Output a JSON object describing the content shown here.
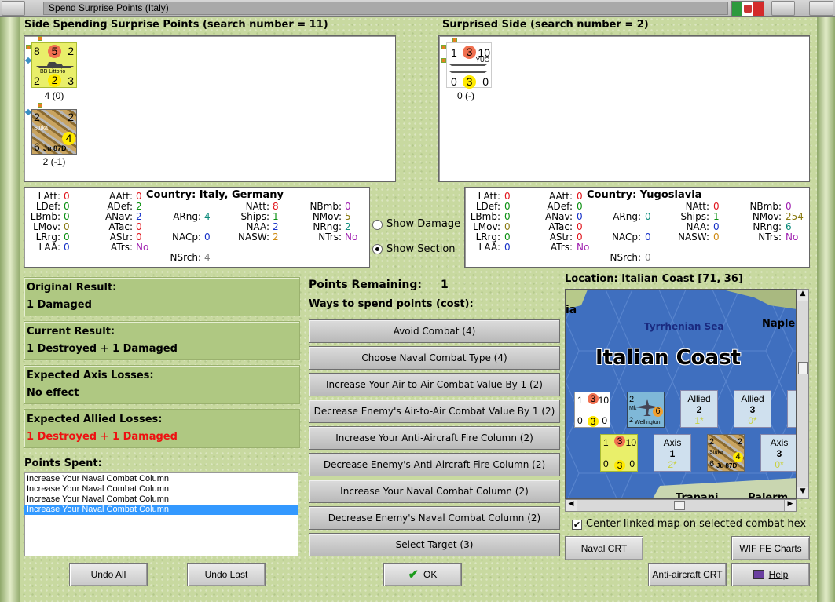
{
  "window": {
    "title": "Spend Surprise Points (Italy)",
    "flag": {
      "colors": [
        "#2e9a3e",
        "#ffffff",
        "#d42a2a"
      ]
    }
  },
  "spending": {
    "header": "Side Spending Surprise Points (search number = 11)",
    "units": [
      {
        "name": "BB Littorio",
        "tl": "8",
        "tc": "5",
        "tr": "2",
        "bl": "2",
        "bc": "2",
        "br": "3",
        "stat": "4 (0)"
      },
      {
        "name": "Ju 87D",
        "tl": "2",
        "tr": "2",
        "bl": "6",
        "br": "4",
        "side": "Stuka",
        "stat": "2 (-1)"
      }
    ]
  },
  "surprised": {
    "header": "Surprised Side (search number = 2)",
    "units": [
      {
        "name": "YUG",
        "tl": "1",
        "tc": "3",
        "tr": "10",
        "bl": "0",
        "bc": "3",
        "br": "0",
        "stat": "0 (-)"
      }
    ]
  },
  "left_stats": {
    "country_label": "Country:",
    "country": "Italy, Germany",
    "col1": [
      [
        "LAtt:",
        "0"
      ],
      [
        "LDef:",
        "0"
      ],
      [
        "LBmb:",
        "0"
      ],
      [
        "LMov:",
        "0"
      ],
      [
        "LRrg:",
        "0"
      ],
      [
        "LAA:",
        "0"
      ]
    ],
    "col2": [
      [
        "AAtt:",
        "0"
      ],
      [
        "ADef:",
        "2"
      ],
      [
        "ANav:",
        "2"
      ],
      [
        "ATac:",
        "0"
      ],
      [
        "AStr:",
        "0"
      ],
      [
        "ATrs:",
        "No"
      ]
    ],
    "col3": [
      [
        "ARng:",
        "4"
      ],
      [
        "NACp:",
        "0"
      ],
      [
        "NSrch:",
        "4"
      ]
    ],
    "col4": [
      [
        "NAtt:",
        "8"
      ],
      [
        "Ships:",
        "1"
      ],
      [
        "NAA:",
        "2"
      ],
      [
        "NASW:",
        "2"
      ]
    ],
    "col5": [
      [
        "NBmb:",
        "0"
      ],
      [
        "NMov:",
        "5"
      ],
      [
        "NRng:",
        "2"
      ],
      [
        "NTrs:",
        "No"
      ]
    ]
  },
  "right_stats": {
    "country_label": "Country:",
    "country": "Yugoslavia",
    "col1": [
      [
        "LAtt:",
        "0"
      ],
      [
        "LDef:",
        "0"
      ],
      [
        "LBmb:",
        "0"
      ],
      [
        "LMov:",
        "0"
      ],
      [
        "LRrg:",
        "0"
      ],
      [
        "LAA:",
        "0"
      ]
    ],
    "col2": [
      [
        "AAtt:",
        "0"
      ],
      [
        "ADef:",
        "0"
      ],
      [
        "ANav:",
        "0"
      ],
      [
        "ATac:",
        "0"
      ],
      [
        "AStr:",
        "0"
      ],
      [
        "ATrs:",
        "No"
      ]
    ],
    "col3": [
      [
        "ARng:",
        "0"
      ],
      [
        "NACp:",
        "0"
      ],
      [
        "NSrch:",
        "0"
      ]
    ],
    "col4": [
      [
        "NAtt:",
        "0"
      ],
      [
        "Ships:",
        "1"
      ],
      [
        "NAA:",
        "0"
      ],
      [
        "NASW:",
        "0"
      ]
    ],
    "col5": [
      [
        "NBmb:",
        "0"
      ],
      [
        "NMov:",
        "254"
      ],
      [
        "NRng:",
        "6"
      ],
      [
        "NTrs:",
        "No"
      ]
    ]
  },
  "options": {
    "show_damage": "Show Damage",
    "show_section": "Show Section",
    "selected": "show_section"
  },
  "results": [
    {
      "title": "Original Result:",
      "value": "1 Damaged"
    },
    {
      "title": "Current Result:",
      "value": "1 Destroyed + 1 Damaged"
    },
    {
      "title": "Expected Axis Losses:",
      "value": "No effect"
    },
    {
      "title": "Expected Allied Losses:",
      "value": "1 Destroyed + 1 Damaged"
    }
  ],
  "points": {
    "label": "Points Remaining:",
    "value": "1",
    "ways": "Ways to spend points (cost):"
  },
  "actions": [
    "Avoid Combat (4)",
    "Choose Naval Combat Type (4)",
    "Increase Your Air-to-Air Combat Value By 1 (2)",
    "Decrease Enemy's Air-to-Air Combat Value By 1 (2)",
    "Increase Your Anti-Aircraft Fire Column (2)",
    "Decrease Enemy's Anti-Aircraft Fire Column (2)",
    "Increase Your Naval Combat Column (2)",
    "Decrease Enemy's Naval Combat Column (2)",
    "Select Target (3)"
  ],
  "spent": {
    "label": "Points Spent:",
    "items": [
      "Increase Your Naval Combat Column",
      "Increase Your Naval Combat Column",
      "Increase Your Naval Combat Column",
      "Increase Your Naval Combat Column"
    ],
    "selected_index": 3
  },
  "map": {
    "location": "Location: Italian Coast [71, 36]",
    "title": "Italian Coast",
    "sea": "Tyrrhenian Sea",
    "town1": "Naple",
    "town2": "ia",
    "town3": "Trapani",
    "town4": "Palerm",
    "cells": [
      {
        "side": "Allied",
        "n": "2",
        "sub": "1*"
      },
      {
        "side": "Allied",
        "n": "3",
        "sub": "0*"
      },
      {
        "side": "Axis",
        "n": "1",
        "sub": "2*"
      },
      {
        "side": "Axis",
        "n": "3",
        "sub": "0*"
      }
    ],
    "units": {
      "yug": {
        "tl": "1",
        "tc": "3",
        "tr": "10",
        "bl": "0",
        "bc": "3",
        "br": "0"
      },
      "wellington": {
        "name": "Wellington",
        "tl": "2",
        "br": "6",
        "bl": "2",
        "mk": "Mk"
      },
      "littorio": {
        "tl": "1",
        "tc": "3",
        "tr": "10",
        "bl": "0",
        "bc": "3",
        "br": "0"
      },
      "stuka": {
        "name": "Ju 87D",
        "tl": "2",
        "tr": "2",
        "bl": "6",
        "br": "4",
        "side": "Stuka"
      }
    }
  },
  "center_linked": {
    "label": "Center linked map on selected combat hex",
    "checked": true
  },
  "buttons": {
    "naval_crt": "Naval CRT",
    "wif_fe": "WIF FE Charts",
    "aa_crt": "Anti-aircraft CRT",
    "help": "Help",
    "undo_all": "Undo All",
    "undo_last": "Undo Last",
    "ok": "OK"
  }
}
